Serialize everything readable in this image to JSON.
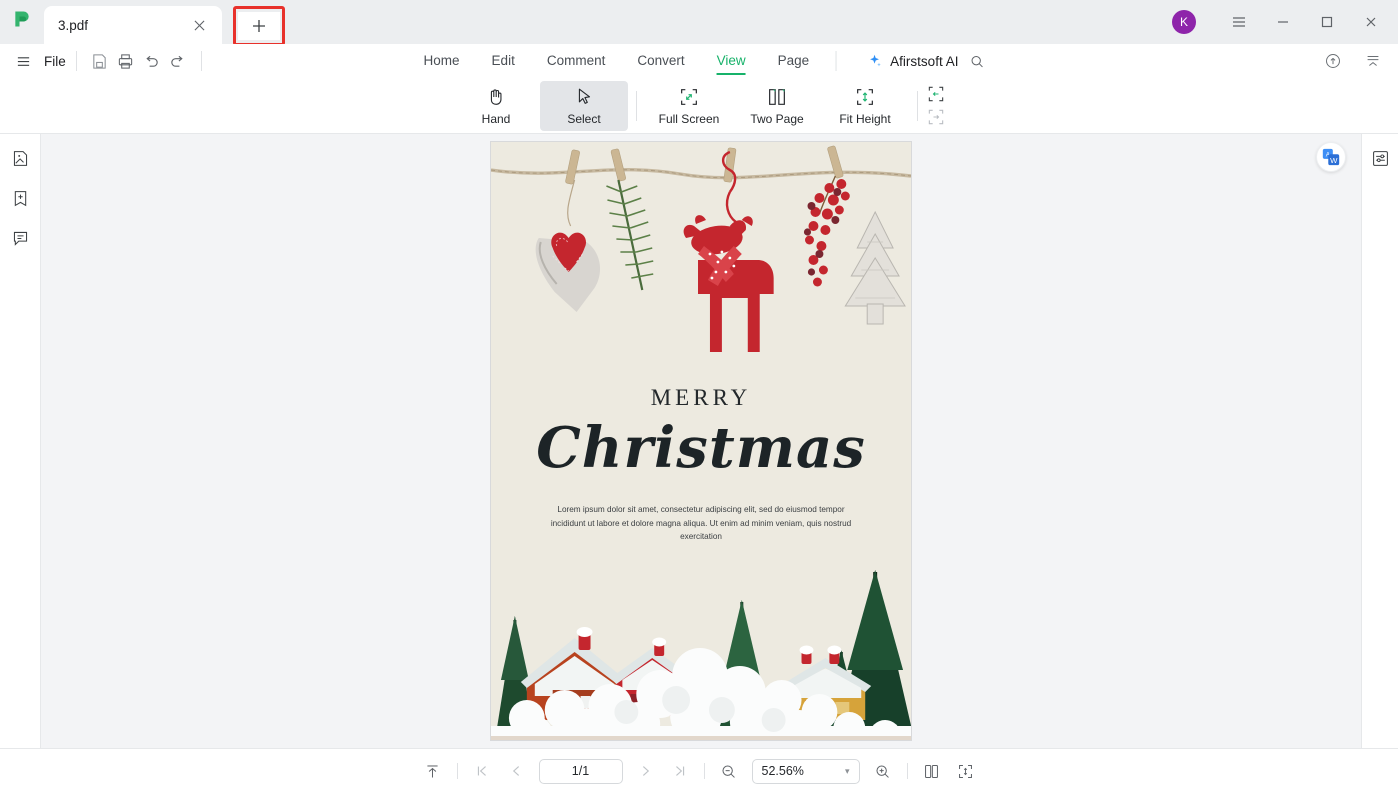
{
  "window": {
    "tab": {
      "title": "3.pdf",
      "close_icon": "close-icon"
    },
    "new_tab_label": "+",
    "avatar_initial": "K",
    "controls": {
      "menu": "≡",
      "minimize": "—",
      "maximize": "□",
      "close": "✕"
    },
    "highlight_color": "#e8312b"
  },
  "menubar": {
    "file_label": "File",
    "quick_tools": [
      "save-icon",
      "print-icon",
      "undo-icon",
      "redo-icon"
    ],
    "tabs": [
      {
        "label": "Home",
        "active": false
      },
      {
        "label": "Edit",
        "active": false
      },
      {
        "label": "Comment",
        "active": false
      },
      {
        "label": "Convert",
        "active": false
      },
      {
        "label": "View",
        "active": true
      },
      {
        "label": "Page",
        "active": false
      }
    ],
    "ai_label": "Afirstsoft AI",
    "search_icon": "search-icon",
    "cloud_icon": "cloud-upload-icon",
    "collapse_icon": "collapse-ribbon-icon",
    "accent_color": "#17b26a"
  },
  "ribbon": {
    "items": [
      {
        "label": "Hand",
        "icon": "hand-icon",
        "active": false
      },
      {
        "label": "Select",
        "icon": "cursor-icon",
        "active": true
      },
      {
        "label": "Full Screen",
        "icon": "fullscreen-icon",
        "active": false
      },
      {
        "label": "Two Page",
        "icon": "two-page-icon",
        "active": false
      },
      {
        "label": "Fit Height",
        "icon": "fit-height-icon",
        "active": false
      }
    ],
    "extra": [
      {
        "icon": "fit-width-icon",
        "active": true
      },
      {
        "icon": "fit-page-icon",
        "active": false
      }
    ]
  },
  "left_rail": [
    {
      "icon": "thumbnail-icon"
    },
    {
      "icon": "bookmark-add-icon"
    },
    {
      "icon": "comment-list-icon"
    }
  ],
  "right_rail": [
    {
      "icon": "properties-panel-icon"
    }
  ],
  "canvas": {
    "translate_icon": "translate-to-word-icon",
    "page_background": "#edeae0"
  },
  "document": {
    "heading_small": "MERRY",
    "heading_large": "Christmas",
    "body_text": "Lorem ipsum dolor sit amet, consectetur adipiscing elit, sed do eiusmod tempor incididunt ut labore et dolore magna aliqua. Ut enim ad minim veniam, quis nostrud exercitation",
    "art_top": "christmas-ornaments-on-rope-photo",
    "art_bottom": "miniature-snow-village-photo"
  },
  "statusbar": {
    "scroll_top_icon": "scroll-to-top-icon",
    "first_page_icon": "first-page-icon",
    "prev_page_icon": "previous-page-icon",
    "page_value": "1/1",
    "next_page_icon": "next-page-icon",
    "last_page_icon": "last-page-icon",
    "zoom_out_icon": "zoom-out-icon",
    "zoom_value": "52.56%",
    "zoom_in_icon": "zoom-in-icon",
    "two_page_icon": "two-page-view-icon",
    "fit_icon": "fit-page-view-icon"
  }
}
